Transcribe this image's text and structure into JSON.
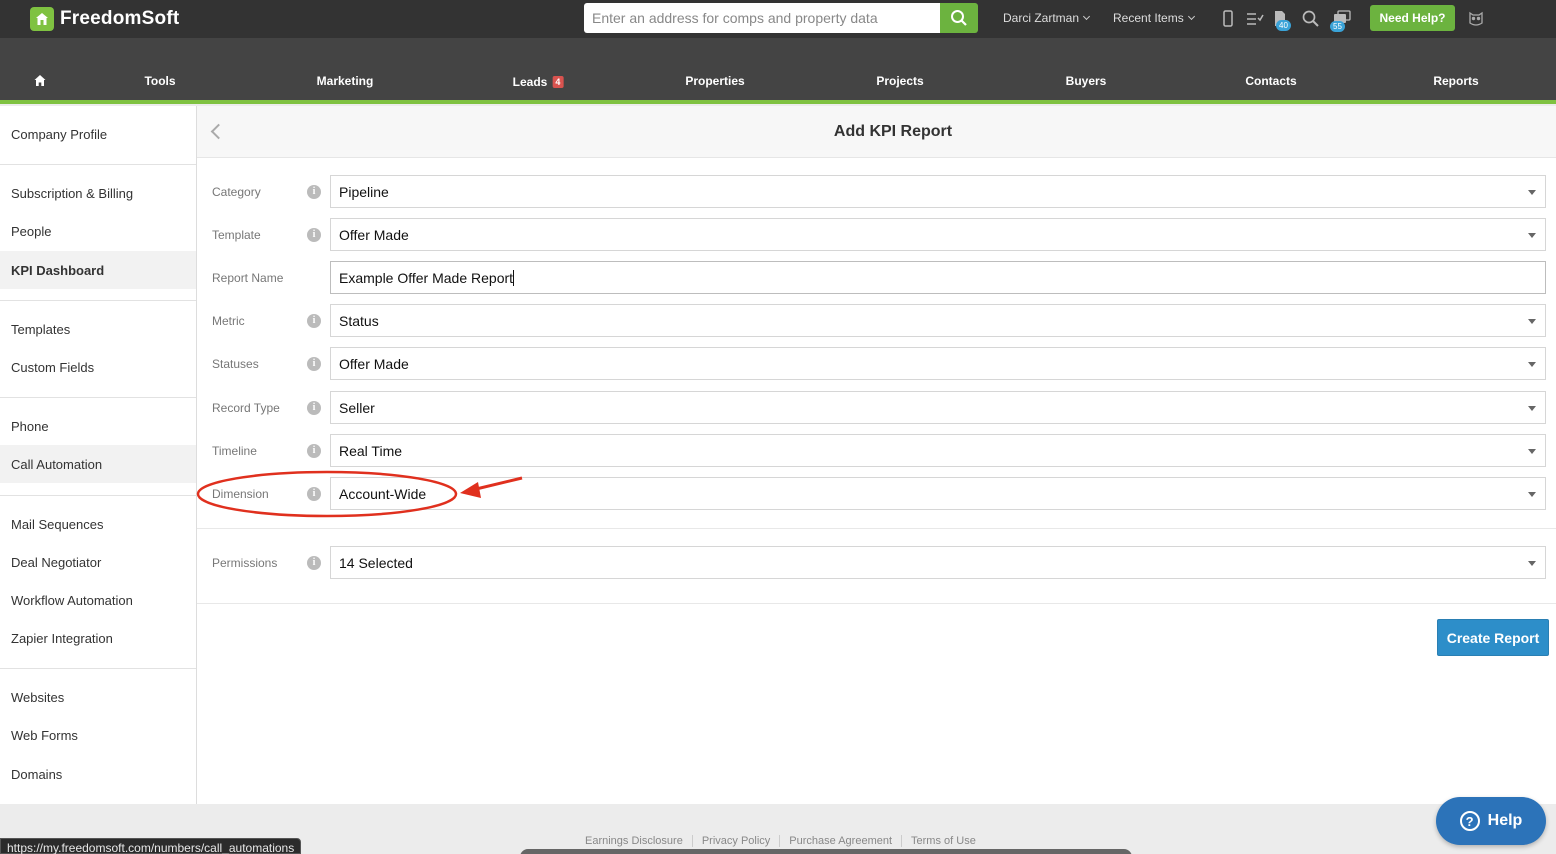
{
  "app": {
    "logo_text": "FreedomSoft",
    "search_placeholder": "Enter an address for comps and property data",
    "user_name": "Darci Zartman",
    "recent_items": "Recent Items",
    "notif_badge_1": "40",
    "notif_badge_2": "55",
    "need_help": "Need Help?"
  },
  "nav": {
    "items": [
      "Tools",
      "Marketing",
      "Leads",
      "Properties",
      "Projects",
      "Buyers",
      "Contacts",
      "Reports"
    ],
    "leads_badge": "4"
  },
  "sidebar": {
    "items": [
      "Company Profile",
      "Subscription & Billing",
      "People",
      "KPI Dashboard",
      "Templates",
      "Custom Fields",
      "Phone",
      "Call Automation",
      "Mail Sequences",
      "Deal Negotiator",
      "Workflow Automation",
      "Zapier Integration",
      "Websites",
      "Web Forms",
      "Domains"
    ],
    "active": "KPI Dashboard"
  },
  "page": {
    "title": "Add KPI Report",
    "fields": [
      {
        "label": "Category",
        "value": "Pipeline",
        "type": "select"
      },
      {
        "label": "Template",
        "value": "Offer Made",
        "type": "select"
      },
      {
        "label": "Report Name",
        "value": "Example Offer Made Report",
        "type": "input"
      },
      {
        "label": "Metric",
        "value": "Status",
        "type": "select"
      },
      {
        "label": "Statuses",
        "value": "Offer Made",
        "type": "select"
      },
      {
        "label": "Record Type",
        "value": "Seller",
        "type": "select"
      },
      {
        "label": "Timeline",
        "value": "Real Time",
        "type": "select"
      },
      {
        "label": "Dimension",
        "value": "Account-Wide",
        "type": "select"
      },
      {
        "label": "Permissions",
        "value": "14 Selected",
        "type": "select"
      }
    ],
    "create_button": "Create Report"
  },
  "footer": {
    "links": [
      "Earnings Disclosure",
      "Privacy Policy",
      "Purchase Agreement",
      "Terms of Use"
    ],
    "status_url": "https://my.freedomsoft.com/numbers/call_automations",
    "help_label": "Help"
  },
  "colors": {
    "brand_green": "#7fc241",
    "button_blue": "#2d8ec9",
    "annotation_red": "#e0301e"
  }
}
